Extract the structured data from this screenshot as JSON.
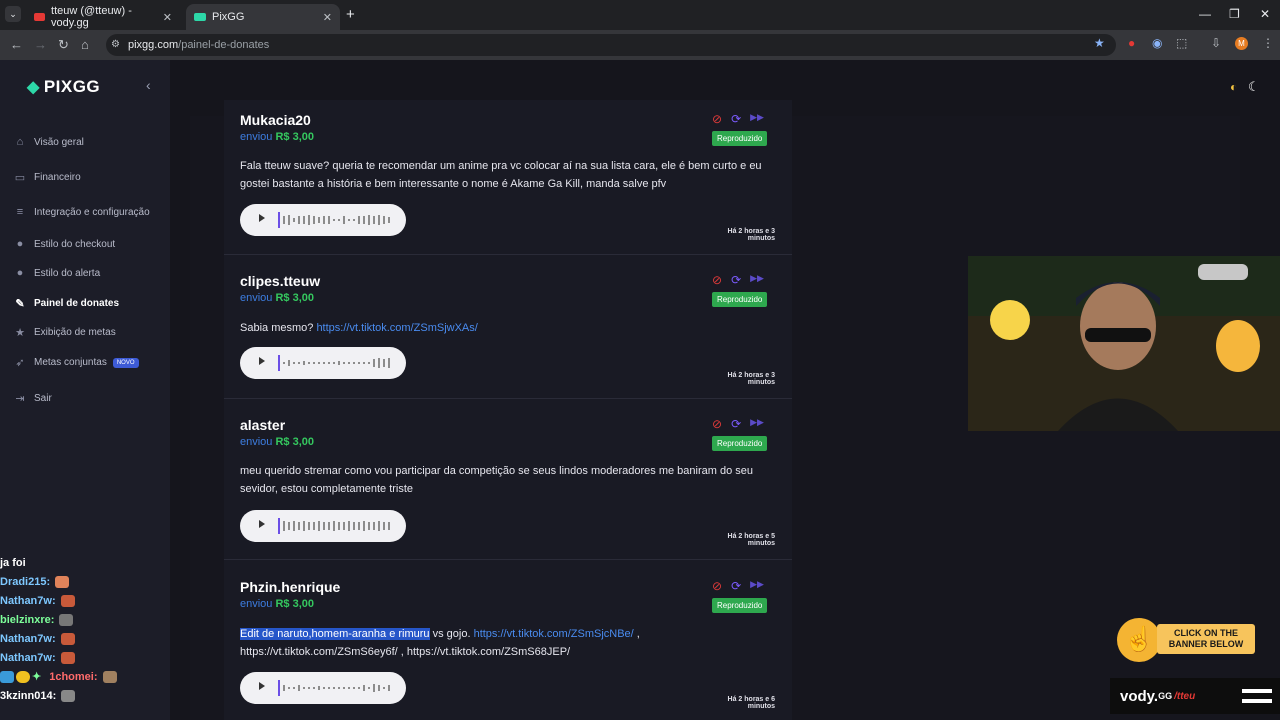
{
  "browser": {
    "tabs": [
      {
        "title": "tteuw (@tteuw) - vody.gg",
        "active": false,
        "favicon_color": "#e53935"
      },
      {
        "title": "PixGG",
        "active": true,
        "favicon_color": "#2dd8a8"
      }
    ],
    "url_host": "pixgg.com",
    "url_path": "/painel-de-donates",
    "profile_initial": "M"
  },
  "app": {
    "logo": "PIXGG",
    "nav": [
      {
        "label": "Visão geral",
        "icon": "home-icon",
        "active": false
      },
      {
        "label": "Financeiro",
        "icon": "wallet-icon",
        "active": false
      },
      {
        "label": "Integração e configuração",
        "icon": "settings-icon",
        "active": false
      },
      {
        "label": "Estilo do checkout",
        "icon": "palette-icon",
        "active": false
      },
      {
        "label": "Estilo do alerta",
        "icon": "palette-icon",
        "active": false
      },
      {
        "label": "Painel de donates",
        "icon": "brush-icon",
        "active": true
      },
      {
        "label": "Exibição de metas",
        "icon": "star-icon",
        "active": false
      },
      {
        "label": "Metas conjuntas",
        "icon": "rocket-icon",
        "active": false,
        "badge": "NOVO"
      },
      {
        "label": "Sair",
        "icon": "logout-icon",
        "active": false
      }
    ]
  },
  "donations": [
    {
      "donor": "Mukacia20",
      "sent_label": "enviou",
      "amount": "R$ 3,00",
      "status": "Reproduzido",
      "time": "Há 2 horas e 3 minutos",
      "message": "Fala tteuw suave? queria te recomendar um anime pra vc colocar aí na sua lista cara, ele é bem curto e eu gostei bastante a história e bem interessante o nome é Akame Ga Kill, manda salve pfv"
    },
    {
      "donor": "clipes.tteuw",
      "sent_label": "enviou",
      "amount": "R$ 3,00",
      "status": "Reproduzido",
      "time": "Há 2 horas e 3 minutos",
      "message_text": "Sabia mesmo? ",
      "message_link": "https://vt.tiktok.com/ZSmSjwXAs/"
    },
    {
      "donor": "alaster",
      "sent_label": "enviou",
      "amount": "R$ 3,00",
      "status": "Reproduzido",
      "time": "Há 2 horas e 5 minutos",
      "message": "meu querido stremar como vou participar da competição se seus lindos moderadores me baniram do seu sevidor, estou completamente triste"
    },
    {
      "donor": "Phzin.henrique",
      "sent_label": "enviou",
      "amount": "R$ 3,00",
      "status": "Reproduzido",
      "time": "Há 2 horas e 6 minutos",
      "message_selected": "Edit de naruto,homem-aranha e rimuru",
      "message_rest": " vs gojo. ",
      "message_link": "https://vt.tiktok.com/ZSmSjcNBe/",
      "message_after": " , https://vt.tiktok.com/ZSmS6ey6f/ , https://vt.tiktok.com/ZSmS68JEP/"
    }
  ],
  "chat": [
    {
      "user": "",
      "text": "ja foi"
    },
    {
      "user": "Dradi215:",
      "text": ""
    },
    {
      "user": "Nathan7w:",
      "text": ""
    },
    {
      "user": "bielzinxre:",
      "text": ""
    },
    {
      "user": "Nathan7w:",
      "text": ""
    },
    {
      "user": "Nathan7w:",
      "text": ""
    },
    {
      "user": "1chomei:",
      "text": ""
    },
    {
      "user": "3kzinn014:",
      "text": ""
    }
  ],
  "overlay": {
    "cta_text": "CLICK ON THE BANNER BELOW",
    "brand": "vody.",
    "brand_suffix": "GG",
    "brand_handle": "/tteu"
  }
}
